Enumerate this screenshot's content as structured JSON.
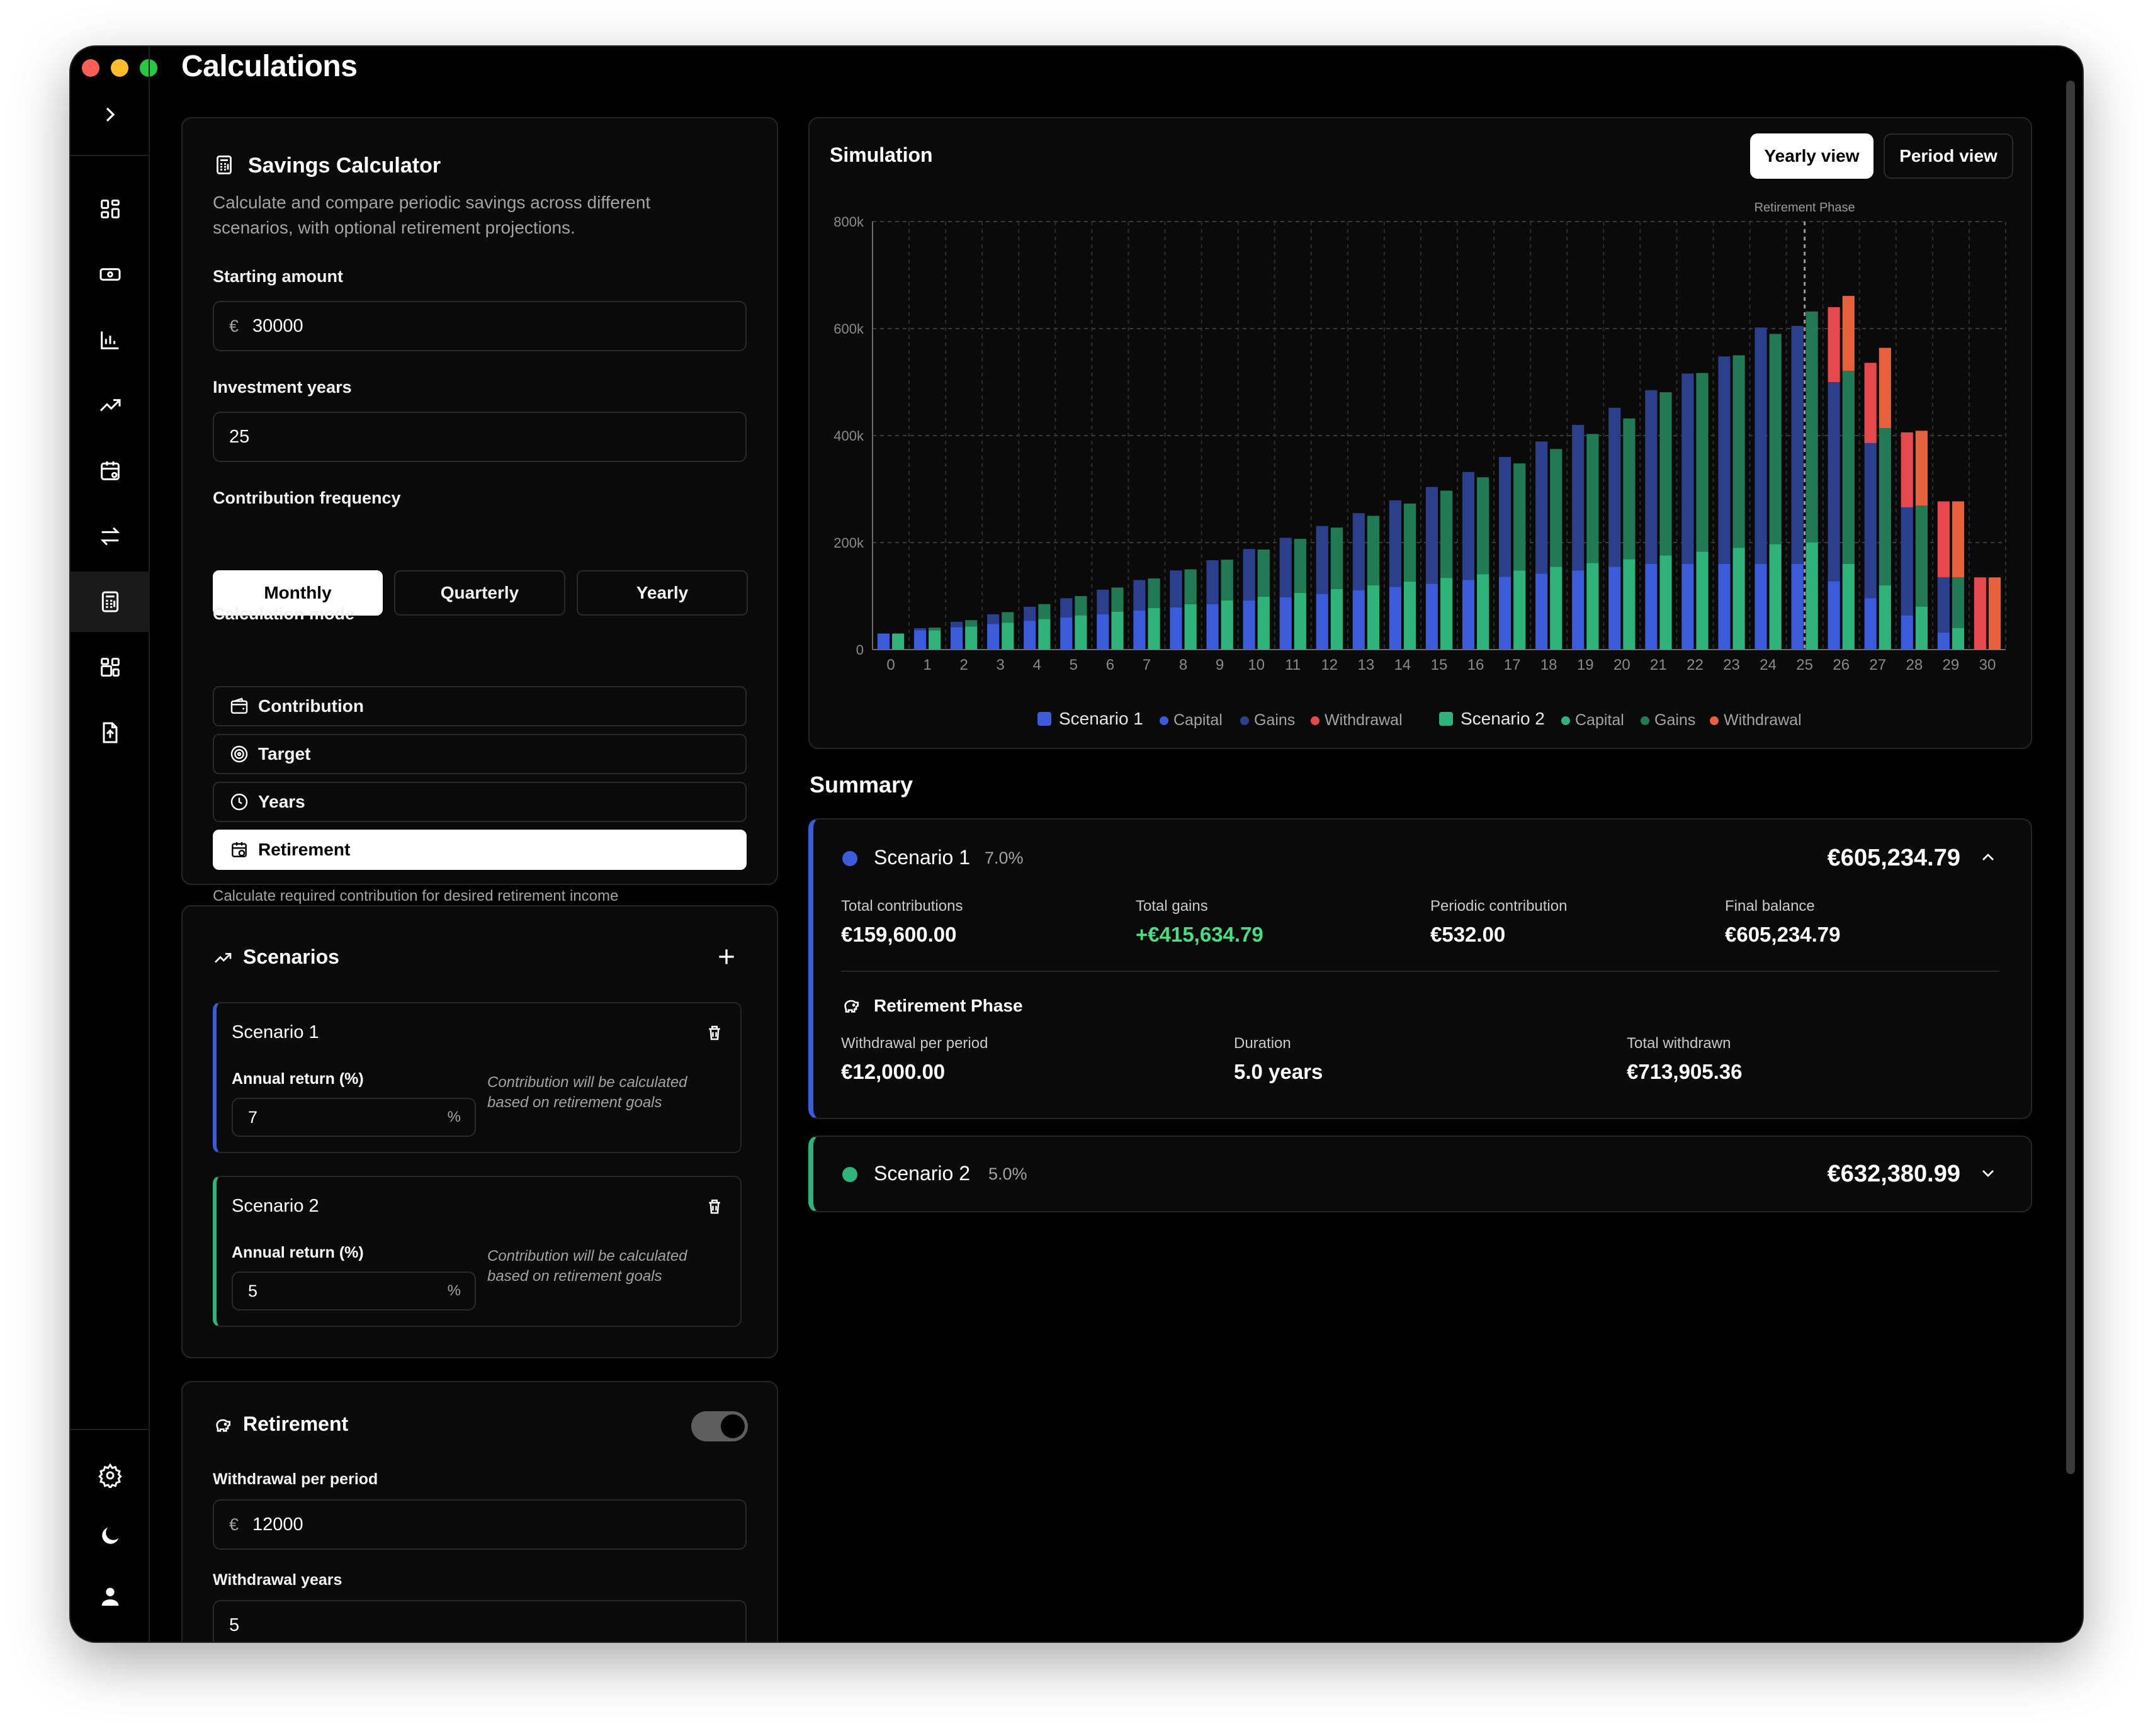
{
  "app": {
    "title": "Calculations"
  },
  "calculator": {
    "title": "Savings Calculator",
    "description_line1": "Calculate and compare periodic savings across different",
    "description_line2": "scenarios, with optional retirement projections.",
    "starting_amount_label": "Starting amount",
    "currency_symbol": "€",
    "starting_amount_value": "30000",
    "investment_years_label": "Investment years",
    "investment_years_value": "25",
    "frequency_label": "Contribution frequency",
    "frequency_options": [
      "Monthly",
      "Quarterly",
      "Yearly"
    ],
    "frequency_selected": "Monthly",
    "mode_label": "Calculation mode",
    "modes": [
      "Contribution",
      "Target",
      "Years",
      "Retirement"
    ],
    "mode_selected": "Retirement",
    "mode_hint": "Calculate required contribution for desired retirement income"
  },
  "scenarios_panel": {
    "title": "Scenarios",
    "items": [
      {
        "name": "Scenario 1",
        "return_label": "Annual return (%)",
        "return_value": "7",
        "unit": "%",
        "note_line1": "Contribution will be calculated",
        "note_line2": "based on retirement goals",
        "color": "#3b5bdb"
      },
      {
        "name": "Scenario 2",
        "return_label": "Annual return (%)",
        "return_value": "5",
        "unit": "%",
        "note_line1": "Contribution will be calculated",
        "note_line2": "based on retirement goals",
        "color": "#2fb37a"
      }
    ]
  },
  "retirement_panel": {
    "title": "Retirement",
    "enabled": true,
    "withdrawal_label": "Withdrawal per period",
    "withdrawal_value": "12000",
    "years_label": "Withdrawal years",
    "years_value": "5"
  },
  "simulation": {
    "title": "Simulation",
    "yearly_view": "Yearly view",
    "period_view": "Period view",
    "active_view": "Yearly view",
    "retirement_marker_label": "Retirement Phase",
    "legend": {
      "s1": "Scenario 1",
      "s1_capital": "Capital",
      "s1_gains": "Gains",
      "s1_withdrawal": "Withdrawal",
      "s2": "Scenario 2",
      "s2_capital": "Capital",
      "s2_gains": "Gains",
      "s2_withdrawal": "Withdrawal"
    }
  },
  "chart_data": {
    "type": "bar",
    "stacked": true,
    "grid": true,
    "legend_position": "bottom",
    "x": [
      0,
      1,
      2,
      3,
      4,
      5,
      6,
      7,
      8,
      9,
      10,
      11,
      12,
      13,
      14,
      15,
      16,
      17,
      18,
      19,
      20,
      21,
      22,
      23,
      24,
      25,
      26,
      27,
      28,
      29,
      30
    ],
    "y_ticks": [
      "0",
      "200k",
      "400k",
      "600k",
      "800k"
    ],
    "ylim": [
      0,
      800000
    ],
    "retirement_start_x": 25,
    "colors": {
      "s1_capital": "#3b5bdb",
      "s1_gains": "#2c3f8c",
      "s1_withdrawal": "#e5484d",
      "s2_capital": "#2fb37a",
      "s2_gains": "#227a55",
      "s2_withdrawal": "#e8603c"
    },
    "series": [
      {
        "name": "Scenario 1",
        "stack": "s1",
        "capital": [
          30000,
          36000,
          42000,
          48000,
          54000,
          60000,
          66000,
          73000,
          79000,
          85000,
          92000,
          98000,
          104000,
          111000,
          117000,
          123000,
          130000,
          136000,
          142000,
          148000,
          155000,
          160000,
          160000,
          160000,
          160000,
          160000,
          128000,
          96000,
          64000,
          32000,
          0
        ],
        "gains": [
          0,
          4000,
          10000,
          18000,
          26000,
          36000,
          46000,
          57000,
          69000,
          82000,
          96000,
          111000,
          127000,
          144000,
          162000,
          181000,
          202000,
          224000,
          247000,
          272000,
          297000,
          325000,
          356000,
          388000,
          442000,
          445000,
          372000,
          290000,
          202000,
          103000,
          0
        ],
        "withdrawal": [
          0,
          0,
          0,
          0,
          0,
          0,
          0,
          0,
          0,
          0,
          0,
          0,
          0,
          0,
          0,
          0,
          0,
          0,
          0,
          0,
          0,
          0,
          0,
          0,
          0,
          0,
          140000,
          150000,
          140000,
          142000,
          135000
        ]
      },
      {
        "name": "Scenario 2",
        "stack": "s2",
        "capital": [
          30000,
          36000,
          43000,
          50000,
          57000,
          64000,
          71000,
          78000,
          85000,
          92000,
          99000,
          106000,
          113000,
          120000,
          127000,
          134000,
          141000,
          148000,
          155000,
          162000,
          169000,
          176000,
          183000,
          190000,
          197000,
          200000,
          160000,
          120000,
          80000,
          40000,
          0
        ],
        "gains": [
          0,
          5000,
          12000,
          20000,
          28000,
          36000,
          45000,
          55000,
          65000,
          76000,
          88000,
          101000,
          115000,
          130000,
          146000,
          163000,
          181000,
          200000,
          220000,
          241000,
          263000,
          305000,
          334000,
          360000,
          393000,
          432000,
          361000,
          294000,
          189000,
          95000,
          0
        ],
        "withdrawal": [
          0,
          0,
          0,
          0,
          0,
          0,
          0,
          0,
          0,
          0,
          0,
          0,
          0,
          0,
          0,
          0,
          0,
          0,
          0,
          0,
          0,
          0,
          0,
          0,
          0,
          0,
          140000,
          150000,
          140000,
          142000,
          135000
        ]
      }
    ]
  },
  "summary": {
    "title": "Summary",
    "s1": {
      "name": "Scenario 1",
      "rate": "7.0%",
      "total": "€605,234.79",
      "contrib_label": "Total contributions",
      "contrib_value": "€159,600.00",
      "gains_label": "Total gains",
      "gains_value": "+€415,634.79",
      "periodic_label": "Periodic contribution",
      "periodic_value": "€532.00",
      "final_label": "Final balance",
      "final_value": "€605,234.79",
      "ret_title": "Retirement Phase",
      "wd_label": "Withdrawal per period",
      "wd_value": "€12,000.00",
      "dur_label": "Duration",
      "dur_value": "5.0 years",
      "tw_label": "Total withdrawn",
      "tw_value": "€713,905.36"
    },
    "s2": {
      "name": "Scenario 2",
      "rate": "5.0%",
      "total": "€632,380.99"
    }
  },
  "icons": [
    "dashboard-icon",
    "cash-icon",
    "bar-chart-icon",
    "trend-icon",
    "calendar-icon",
    "transfer-icon",
    "calculator-icon",
    "widgets-icon",
    "file-upload-icon",
    "settings-icon",
    "theme-moon-icon",
    "user-icon"
  ]
}
